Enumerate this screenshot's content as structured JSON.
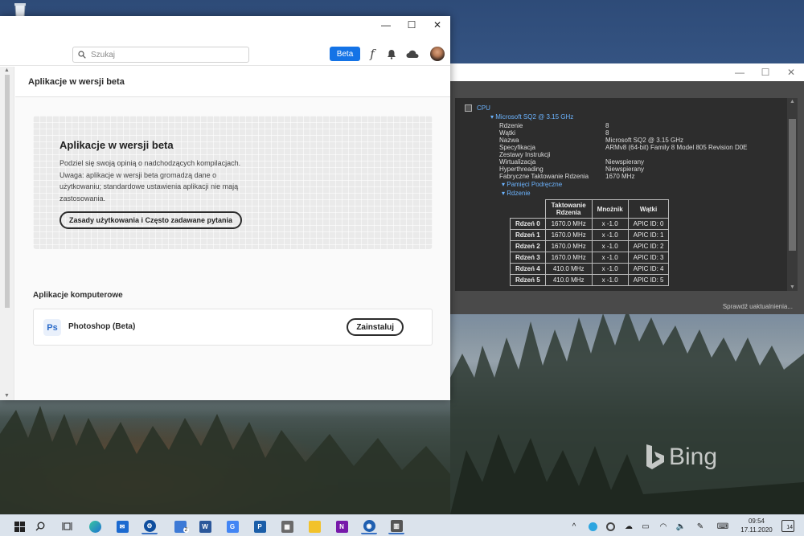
{
  "desktop": {
    "bing_label": "Bing"
  },
  "cc": {
    "search_placeholder": "Szukaj",
    "beta_button": "Beta",
    "section_title": "Aplikacje w wersji beta",
    "card": {
      "title": "Aplikacje w wersji beta",
      "text": "Podziel się swoją opinią o nadchodzących kompilacjach. Uwaga: aplikacje w wersji beta gromadzą dane o użytkowaniu; standardowe ustawienia aplikacji nie mają zastosowania.",
      "terms_button": "Zasady użytkowania i Często zadawane pytania"
    },
    "apps_heading": "Aplikacje komputerowe",
    "app": {
      "icon_text": "Ps",
      "name": "Photoshop (Beta)",
      "install_button": "Zainstaluj"
    }
  },
  "cpu": {
    "root_label": "CPU",
    "processor": "Microsoft SQ2 @ 3.15 GHz",
    "props": [
      {
        "key": "Rdzenie",
        "value": "8"
      },
      {
        "key": "Wątki",
        "value": "8"
      },
      {
        "key": "Nazwa",
        "value": "Microsoft SQ2 @ 3.15 GHz"
      },
      {
        "key": "Specyfikacja",
        "value": "ARMv8 (64-bit) Family 8 Model 805 Revision D0E"
      },
      {
        "key": "Zestawy Instrukcji",
        "value": ""
      },
      {
        "key": "Wirtualizacja",
        "value": "Niewspierany"
      },
      {
        "key": "Hyperthreading",
        "value": "Niewspierany"
      },
      {
        "key": "Fabryczne Taktowanie Rdzenia",
        "value": "1670 MHz"
      }
    ],
    "cache_link": "Pamięci Podręczne",
    "cores_link": "Rdzenie",
    "table_headers": [
      "Taktowanie Rdzenia",
      "Mnożnik",
      "Wątki"
    ],
    "cores": [
      {
        "name": "Rdzeń 0",
        "clock": "1670.0 MHz",
        "mult": "x -1.0",
        "threads": "APIC ID: 0"
      },
      {
        "name": "Rdzeń 1",
        "clock": "1670.0 MHz",
        "mult": "x -1.0",
        "threads": "APIC ID: 1"
      },
      {
        "name": "Rdzeń 2",
        "clock": "1670.0 MHz",
        "mult": "x -1.0",
        "threads": "APIC ID: 2"
      },
      {
        "name": "Rdzeń 3",
        "clock": "1670.0 MHz",
        "mult": "x -1.0",
        "threads": "APIC ID: 3"
      },
      {
        "name": "Rdzeń 4",
        "clock": "410.0 MHz",
        "mult": "x -1.0",
        "threads": "APIC ID: 4"
      },
      {
        "name": "Rdzeń 5",
        "clock": "410.0 MHz",
        "mult": "x -1.0",
        "threads": "APIC ID: 5"
      }
    ],
    "update_link": "Sprawdź uaktualnienia..."
  },
  "taskbar": {
    "word_label": "W",
    "onenote_label": "N",
    "explorer_badge": "2",
    "time": "09:54",
    "date": "17.11.2020",
    "notification_count": "14"
  },
  "colors": {
    "accent": "#1473e6",
    "link_blue": "#6cb4ff"
  }
}
